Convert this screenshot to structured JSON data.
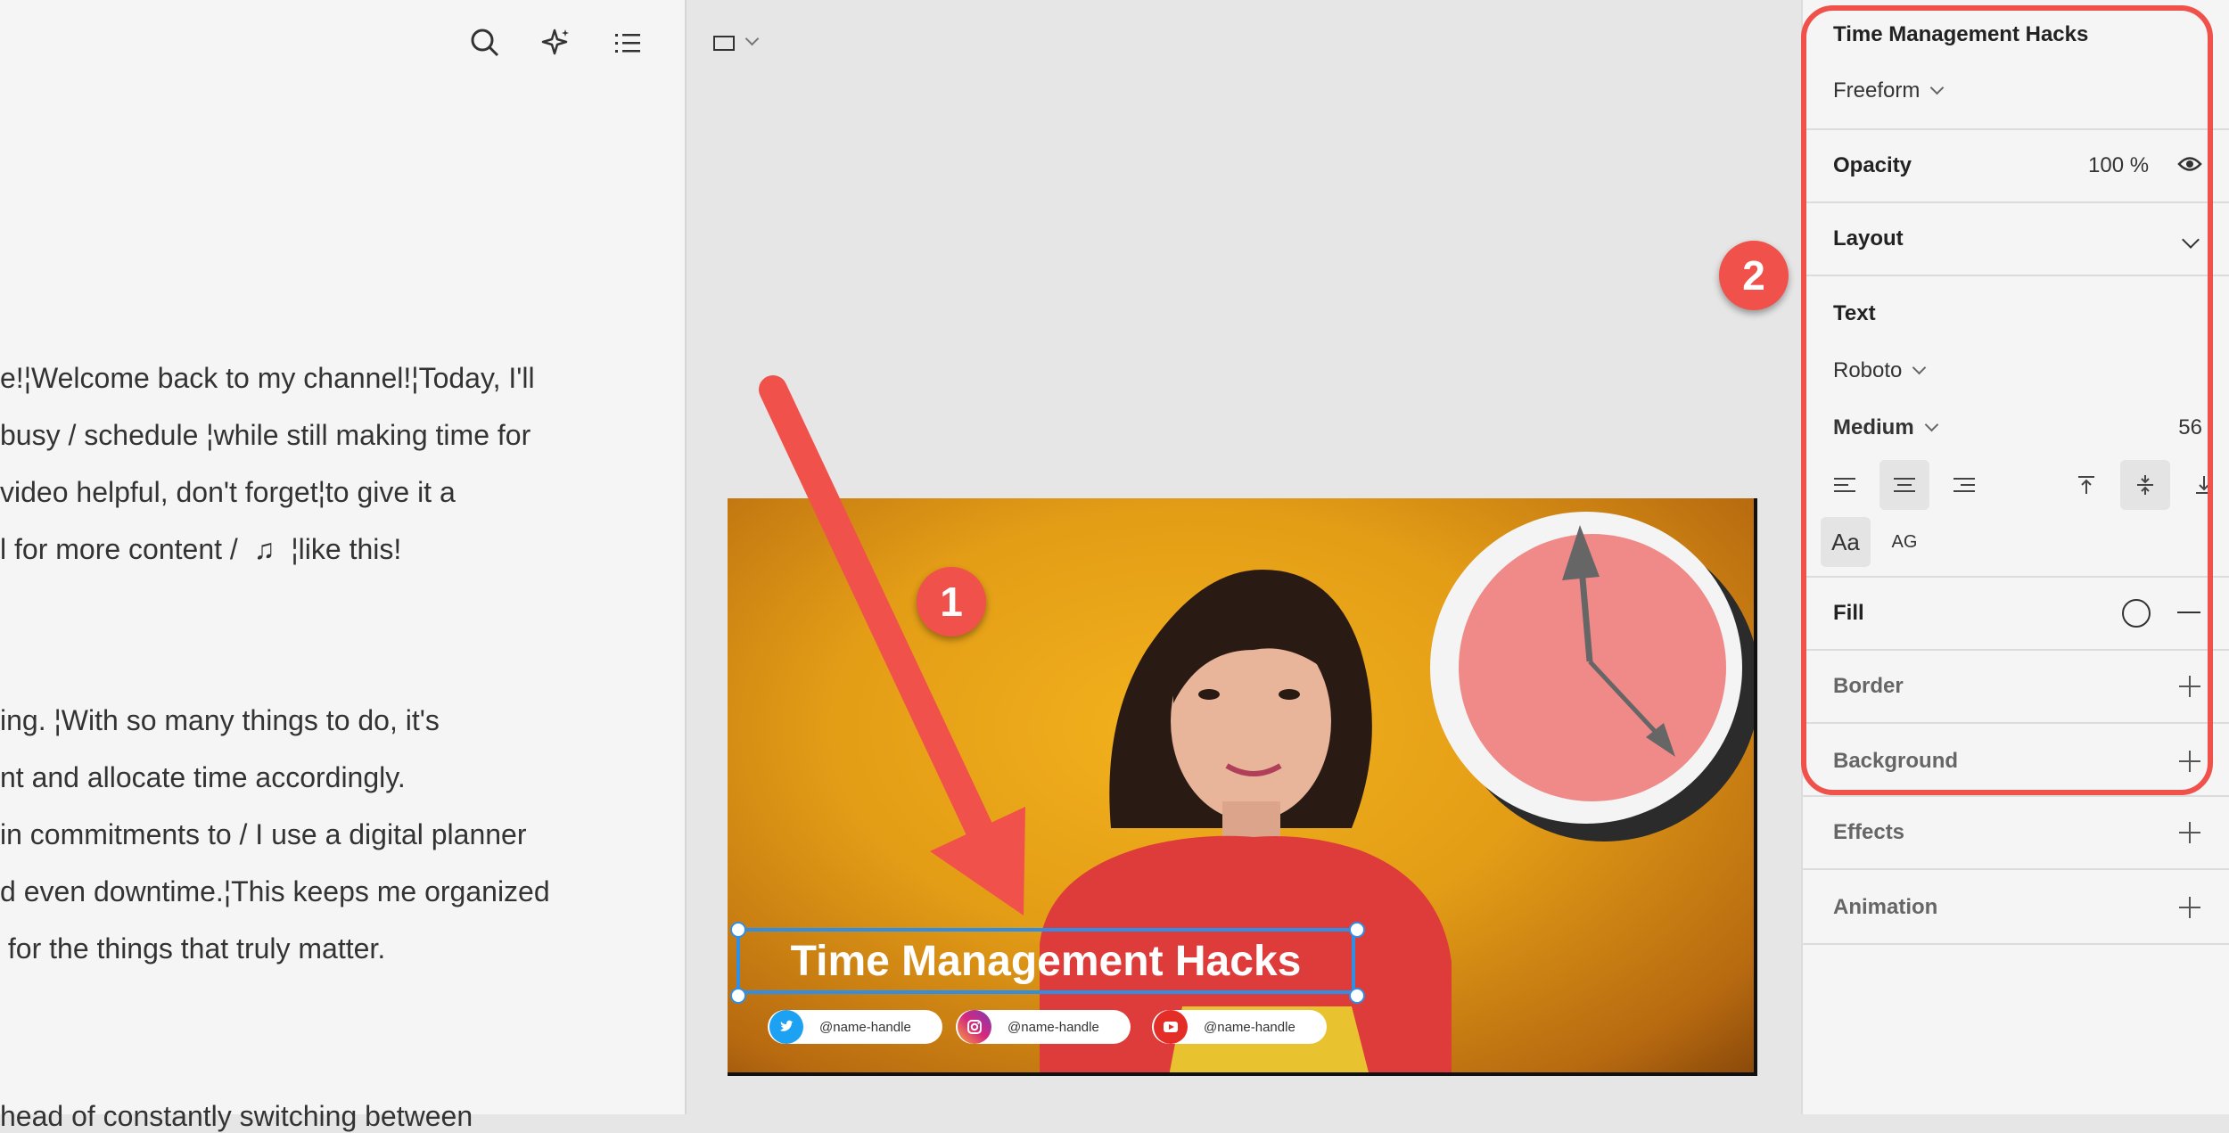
{
  "left_panel": {
    "toolbar": {
      "search": "search-icon",
      "ai": "sparkle-icon",
      "list": "list-icon"
    },
    "script_lines": [
      "e!¦Welcome back to my channel!¦Today, I'll",
      "busy / schedule ¦while still making time for",
      "video helpful, don't forget¦to give it a",
      "l for more content /  ♫  ¦like this!",
      "ing. ¦With so many things to do, it's",
      "nt and allocate time accordingly.",
      "in commitments to / I use a digital planner",
      "d even downtime.¦This keeps me organized",
      " for the things that truly matter.",
      "head of constantly switching between"
    ]
  },
  "canvas": {
    "frame_selector": "frame-icon",
    "thumbnail": {
      "title": "Time Management Hacks",
      "handles": [
        {
          "platform": "twitter",
          "text": "@name-handle",
          "color": "#1da1f2"
        },
        {
          "platform": "instagram",
          "text": "@name-handle",
          "color": "#c13584"
        },
        {
          "platform": "youtube",
          "text": "@name-handle",
          "color": "#e52d27"
        }
      ]
    }
  },
  "properties": {
    "element_name": "Time Management Hacks",
    "mode": "Freeform",
    "opacity_label": "Opacity",
    "opacity_value": "100 %",
    "layout_label": "Layout",
    "text_label": "Text",
    "font_family": "Roboto",
    "font_weight": "Medium",
    "font_size": "56",
    "case_mixed": "Aa",
    "case_upper": "AG",
    "fill_label": "Fill",
    "border_label": "Border",
    "background_label": "Background",
    "effects_label": "Effects",
    "animation_label": "Animation"
  },
  "annotations": {
    "callout_1": "1",
    "callout_2": "2",
    "accent": "#f0524b"
  }
}
